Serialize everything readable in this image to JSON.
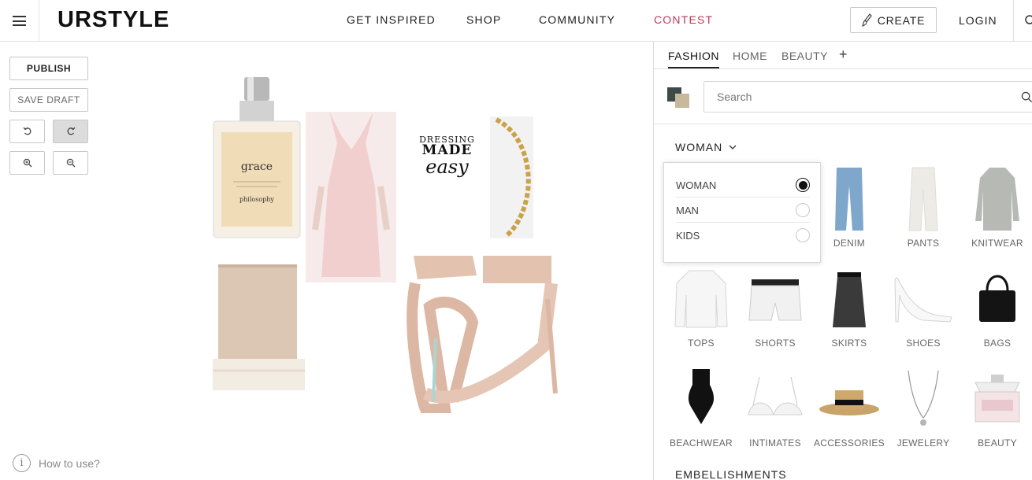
{
  "header": {
    "logo": "URSTYLE",
    "nav": [
      "GET INSPIRED",
      "SHOP",
      "COMMUNITY",
      "CONTEST"
    ],
    "create_label": "CREATE",
    "login_label": "LOGIN",
    "accent_color": "#c2385a"
  },
  "tools": {
    "publish_label": "PUBLISH",
    "save_draft_label": "SAVE DRAFT",
    "icons": [
      "undo-icon",
      "redo-icon",
      "zoom-in-icon",
      "zoom-out-icon"
    ],
    "howto_label": "How to use?"
  },
  "canvas": {
    "perfume_brand": "philosophy",
    "perfume_name": "grace",
    "book_text": [
      "DRESSING",
      "MADE",
      "easy"
    ]
  },
  "panel": {
    "tabs": [
      "FASHION",
      "HOME",
      "BEAUTY"
    ],
    "active_tab": "FASHION",
    "search_placeholder": "Search",
    "gender_selected": "WOMAN",
    "gender_options": [
      "WOMAN",
      "MAN",
      "KIDS"
    ],
    "categories": [
      "DENIM",
      "PANTS",
      "KNITWEAR",
      "TOPS",
      "SHORTS",
      "SKIRTS",
      "SHOES",
      "BAGS",
      "BEACHWEAR",
      "INTIMATES",
      "ACCESSORIES",
      "JEWELERY",
      "BEAUTY"
    ],
    "section_below": "EMBELLISHMENTS"
  }
}
